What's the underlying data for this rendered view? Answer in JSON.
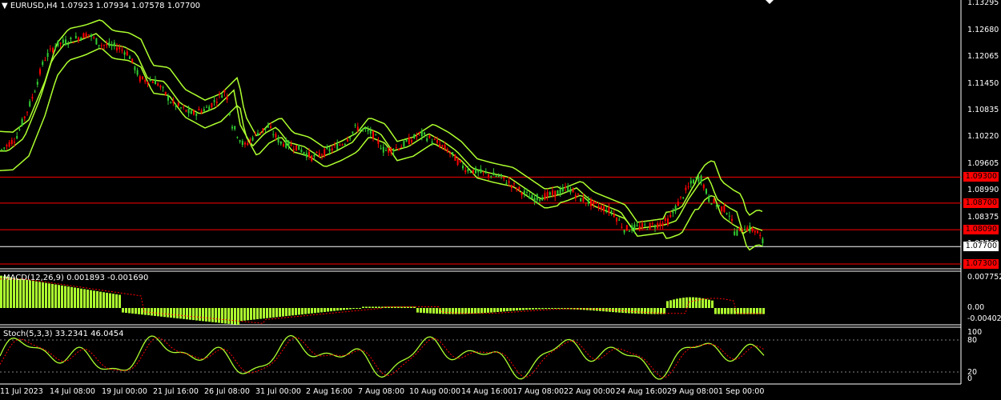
{
  "header": {
    "symbol_timeframe": "EURUSD,H4",
    "ohlc": "1.07923 1.07934 1.07578 1.07700"
  },
  "macd": {
    "label": "MACD(12,26,9) 0.001893 -0.001690",
    "ticks": [
      "0.007752",
      "0.00",
      "-0.004024"
    ]
  },
  "stoch": {
    "label": "Stoch(5,3,3) 33.2341 46.0454",
    "ticks": [
      "100",
      "80",
      "20",
      "0"
    ]
  },
  "price_axis": [
    "1.13295",
    "1.12680",
    "1.12065",
    "1.11450",
    "1.10835",
    "1.10220",
    "1.09605",
    "1.08990",
    "1.08375",
    "1.07760"
  ],
  "levels": [
    {
      "price": "1.09300",
      "color": "#ff0000"
    },
    {
      "price": "1.08700",
      "color": "#ff0000"
    },
    {
      "price": "1.08090",
      "color": "#ff0000"
    },
    {
      "price": "1.07700",
      "color": "#ffffff"
    },
    {
      "price": "1.07300",
      "color": "#ff0000"
    }
  ],
  "time_axis": [
    "11 Jul 2023",
    "14 Jul 08:00",
    "19 Jul 00:00",
    "21 Jul 16:00",
    "26 Jul 08:00",
    "31 Jul 00:00",
    "2 Aug 16:00",
    "7 Aug 08:00",
    "10 Aug 00:00",
    "14 Aug 16:00",
    "17 Aug 08:00",
    "22 Aug 00:00",
    "24 Aug 16:00",
    "29 Aug 08:00",
    "1 Sep 00:00"
  ],
  "colors": {
    "bull": "#32cd32",
    "bear": "#ff0000",
    "band": "#adff2f",
    "macd": "#adff2f",
    "signal": "#ff0000",
    "grid": "#ffffff"
  },
  "chart_data": {
    "type": "line",
    "x": [
      "11 Jul 2023",
      "14 Jul 08:00",
      "19 Jul 00:00",
      "21 Jul 16:00",
      "26 Jul 08:00",
      "31 Jul 00:00",
      "2 Aug 16:00",
      "7 Aug 08:00",
      "10 Aug 00:00",
      "14 Aug 16:00",
      "17 Aug 08:00",
      "22 Aug 00:00",
      "24 Aug 16:00",
      "29 Aug 08:00",
      "1 Sep 00:00"
    ],
    "series": [
      {
        "values": [
          1.1,
          1.124,
          1.122,
          1.112,
          1.106,
          1.1,
          1.096,
          1.1,
          1.101,
          1.093,
          1.089,
          1.085,
          1.08,
          1.092,
          1.079
        ]
      }
    ],
    "ylim": [
      1.073,
      1.133
    ]
  }
}
